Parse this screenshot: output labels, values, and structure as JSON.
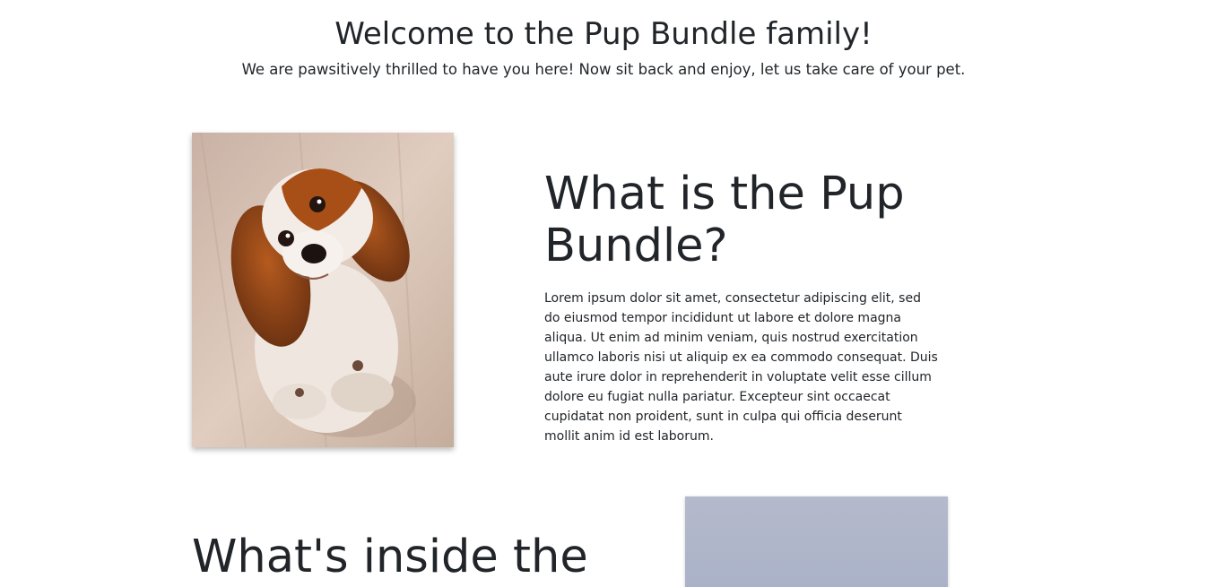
{
  "hero": {
    "title": "Welcome to the Pup Bundle family!",
    "subtitle": "We are pawsitively thrilled to have you here! Now sit back and enjoy, let us take care of your pet."
  },
  "about": {
    "heading": "What is the Pup Bundle?",
    "body": "Lorem ipsum dolor sit amet, consectetur adipiscing elit, sed do eiusmod tempor incididunt ut labore et dolore magna aliqua. Ut enim ad minim veniam, quis nostrud exercitation ullamco laboris nisi ut aliquip ex ea commodo consequat. Duis aute irure dolor in reprehenderit in voluptate velit esse cillum dolore eu fugiat nulla pariatur. Excepteur sint occaecat cupidatat non proident, sunt in culpa qui officia deserunt mollit anim id est laborum."
  },
  "inside": {
    "heading": "What's inside the"
  },
  "images": {
    "puppy_photo": "puppy-photo",
    "second_photo": "product-photo"
  },
  "colors": {
    "text": "#212529",
    "background": "#ffffff"
  }
}
